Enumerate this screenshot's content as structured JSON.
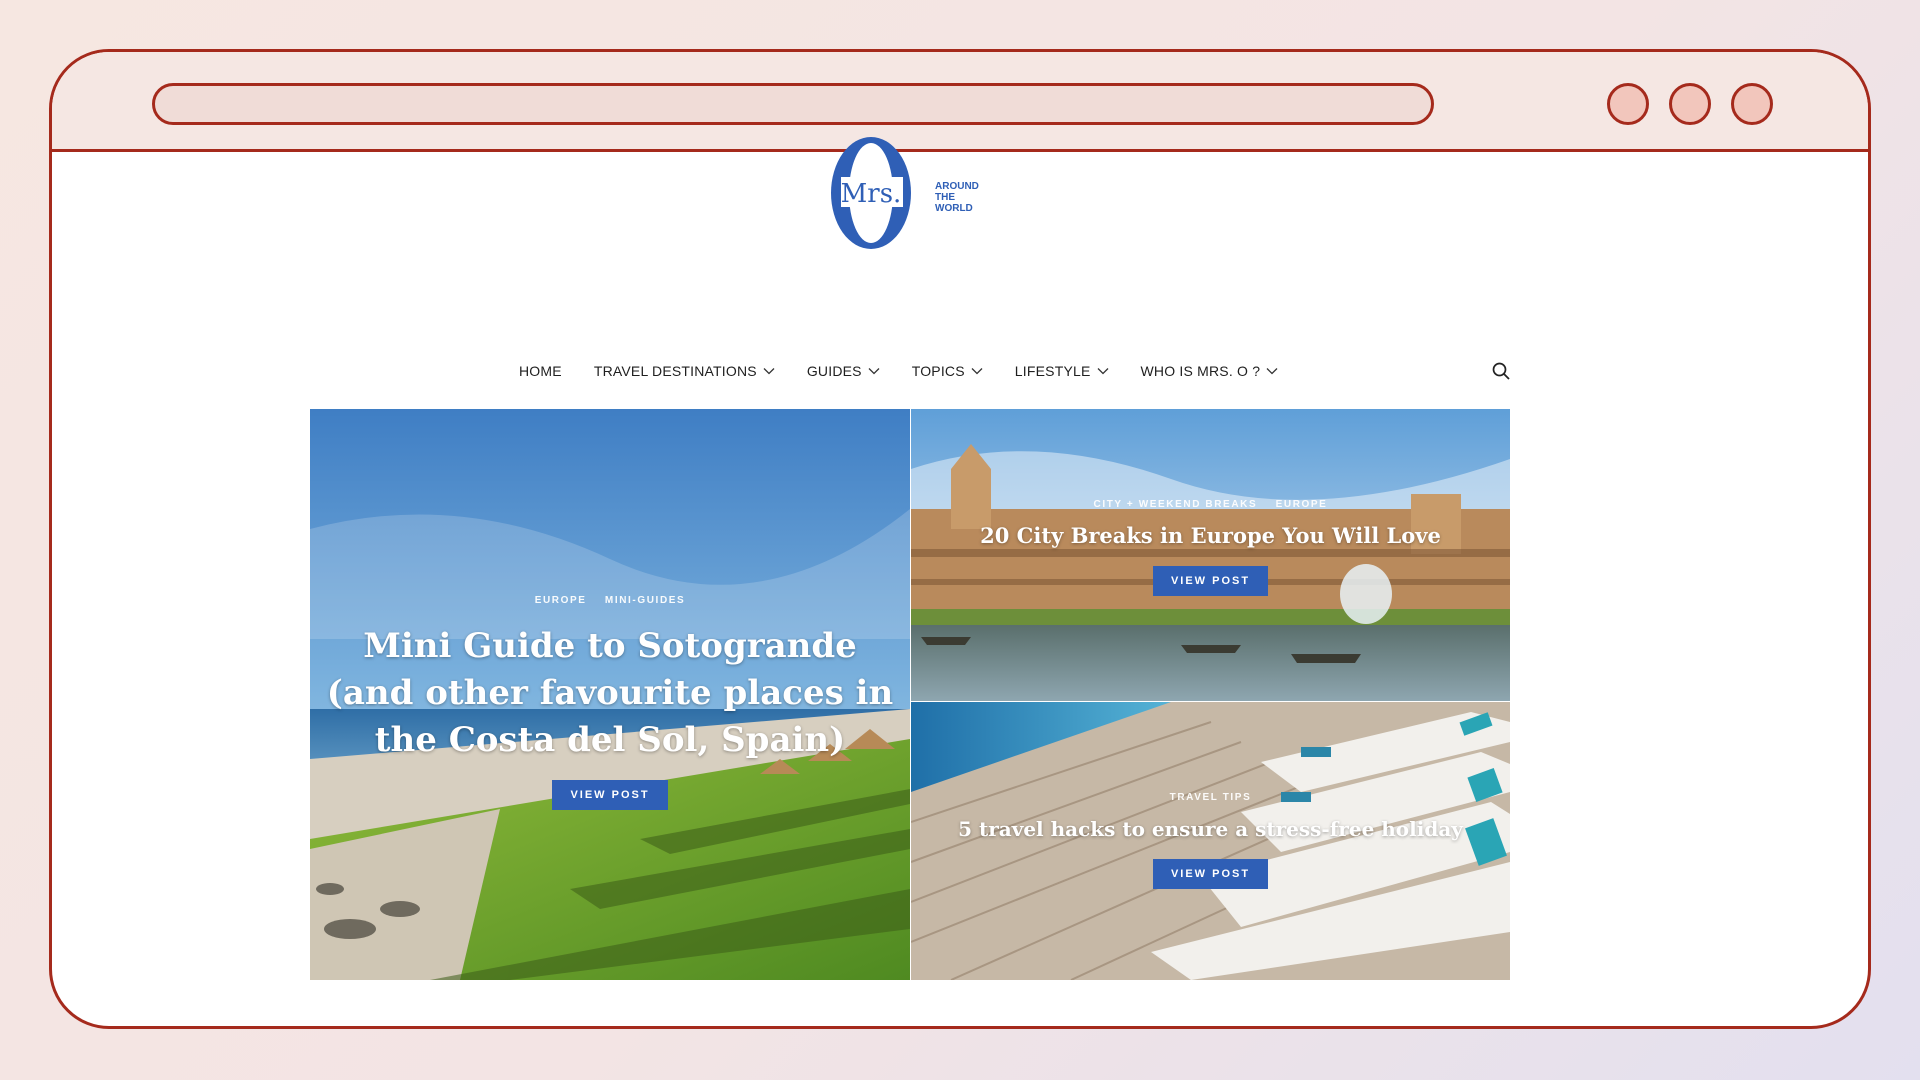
{
  "logo": {
    "monogram": "Mrs.",
    "tagline": [
      "AROUND",
      "THE",
      "WORLD"
    ]
  },
  "nav": {
    "items": [
      {
        "label": "HOME",
        "dropdown": false
      },
      {
        "label": "TRAVEL DESTINATIONS",
        "dropdown": true
      },
      {
        "label": "GUIDES",
        "dropdown": true
      },
      {
        "label": "TOPICS",
        "dropdown": true
      },
      {
        "label": "LIFESTYLE",
        "dropdown": true
      },
      {
        "label": "WHO IS MRS. O ?",
        "dropdown": true
      }
    ],
    "search_icon": "search-icon"
  },
  "posts": {
    "featured": {
      "categories": [
        "EUROPE",
        "MINI-GUIDES"
      ],
      "title_lines": [
        "Mini Guide to Sotogrande",
        "(and other favourite places in",
        "the Costa del Sol, Spain)"
      ],
      "button": "VIEW POST"
    },
    "top_right": {
      "categories": [
        "CITY + WEEKEND BREAKS",
        "EUROPE"
      ],
      "title": "20 City Breaks in Europe You Will Love",
      "button": "VIEW POST"
    },
    "bottom_right": {
      "categories": [
        "TRAVEL TIPS"
      ],
      "title": "5 travel hacks to ensure a stress-free holiday",
      "button": "VIEW POST"
    }
  },
  "colors": {
    "frame": "#a52a1c",
    "brand_blue": "#2f5fb6",
    "button_blue": "#2f5fb6"
  }
}
